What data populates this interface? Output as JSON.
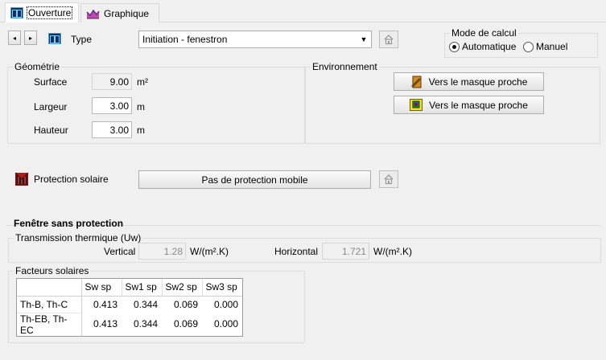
{
  "tabs": [
    {
      "label": "Ouverture",
      "icon": "window-icon",
      "active": true
    },
    {
      "label": "Graphique",
      "icon": "graph-icon",
      "active": false
    }
  ],
  "nav": {
    "prev": "◂",
    "next": "▸"
  },
  "type": {
    "label": "Type",
    "value": "Initiation - fenestron"
  },
  "mode": {
    "legend": "Mode de calcul",
    "options": [
      "Automatique",
      "Manuel"
    ],
    "selected": "Automatique"
  },
  "geometrie": {
    "legend": "Géométrie",
    "surface": {
      "label": "Surface",
      "value": "9.00",
      "unit": "m²"
    },
    "largeur": {
      "label": "Largeur",
      "value": "3.00",
      "unit": "m"
    },
    "hauteur": {
      "label": "Hauteur",
      "value": "3.00",
      "unit": "m"
    }
  },
  "environnement": {
    "legend": "Environnement",
    "btn1": "Vers le masque proche",
    "btn2": "Vers le masque proche"
  },
  "protection": {
    "label": "Protection solaire",
    "value": "Pas de protection mobile"
  },
  "fenetre": {
    "title": "Fenêtre sans protection",
    "transmission": {
      "legend": "Transmission thermique (Uw)",
      "vertical_label": "Vertical",
      "vertical_value": "1.28",
      "vertical_unit": "W/(m².K)",
      "horizontal_label": "Horizontal",
      "horizontal_value": "1.721",
      "horizontal_unit": "W/(m².K)"
    },
    "facteurs": {
      "legend": "Facteurs solaires",
      "columns": [
        "Sw sp",
        "Sw1 sp",
        "Sw2 sp",
        "Sw3 sp"
      ],
      "rows": [
        {
          "label": "Th-B, Th-C",
          "values": [
            "0.413",
            "0.344",
            "0.069",
            "0.000"
          ]
        },
        {
          "label": "Th-EB, Th-EC",
          "values": [
            "0.413",
            "0.344",
            "0.069",
            "0.000"
          ]
        }
      ]
    }
  }
}
